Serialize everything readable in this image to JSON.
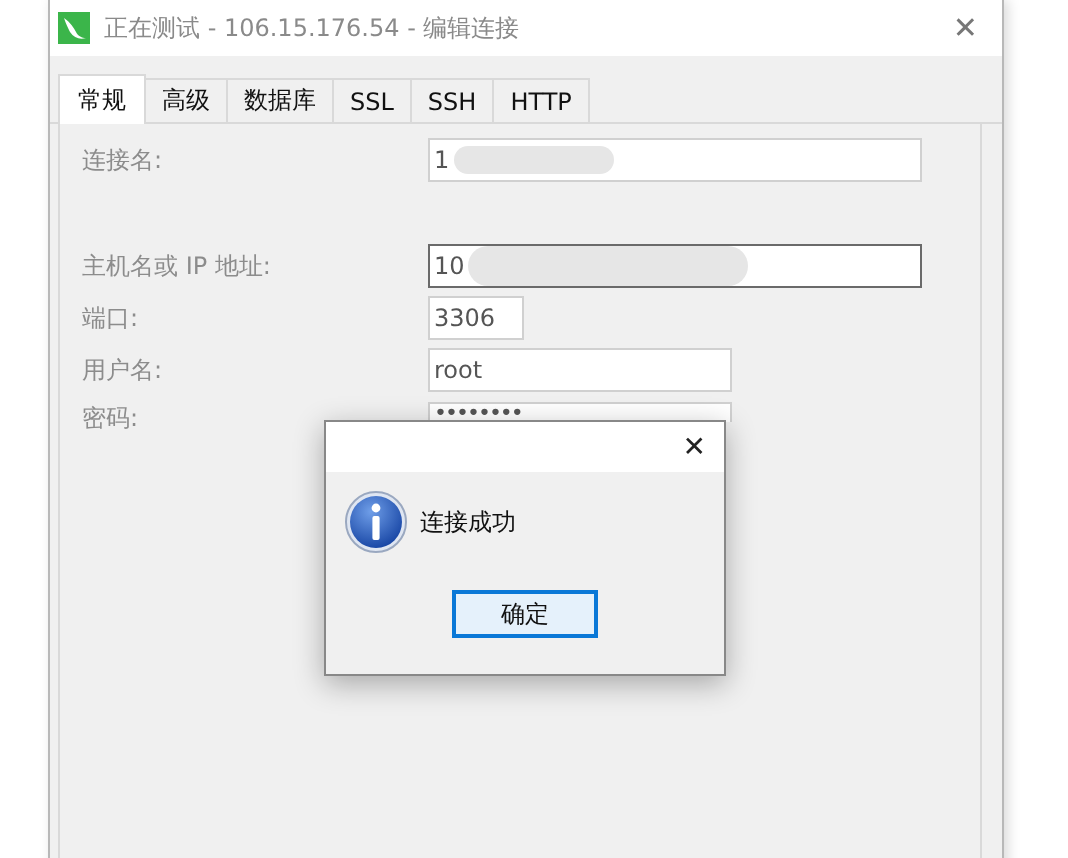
{
  "window": {
    "title": "正在测试 - 106.15.176.54 - 编辑连接",
    "close": "✕"
  },
  "tabs": [
    {
      "label": "常规",
      "selected": true
    },
    {
      "label": "高级",
      "selected": false
    },
    {
      "label": "数据库",
      "selected": false
    },
    {
      "label": "SSL",
      "selected": false
    },
    {
      "label": "SSH",
      "selected": false
    },
    {
      "label": "HTTP",
      "selected": false
    }
  ],
  "fields": [
    {
      "label": "连接名:",
      "value": "1",
      "kind": "wide",
      "focused": false,
      "redacted": true
    },
    {
      "label": "主机名或 IP 地址:",
      "value": "10",
      "kind": "wide",
      "focused": true,
      "redacted": true
    },
    {
      "label": "端口:",
      "value": "3306",
      "kind": "short",
      "focused": false,
      "redacted": false
    },
    {
      "label": "用户名:",
      "value": "root",
      "kind": "medium",
      "focused": false,
      "redacted": false
    },
    {
      "label": "密码:",
      "value": "••••••••",
      "kind": "medium",
      "focused": false,
      "redacted": false
    }
  ],
  "message_box": {
    "close": "✕",
    "message": "连接成功",
    "button": "确定"
  }
}
